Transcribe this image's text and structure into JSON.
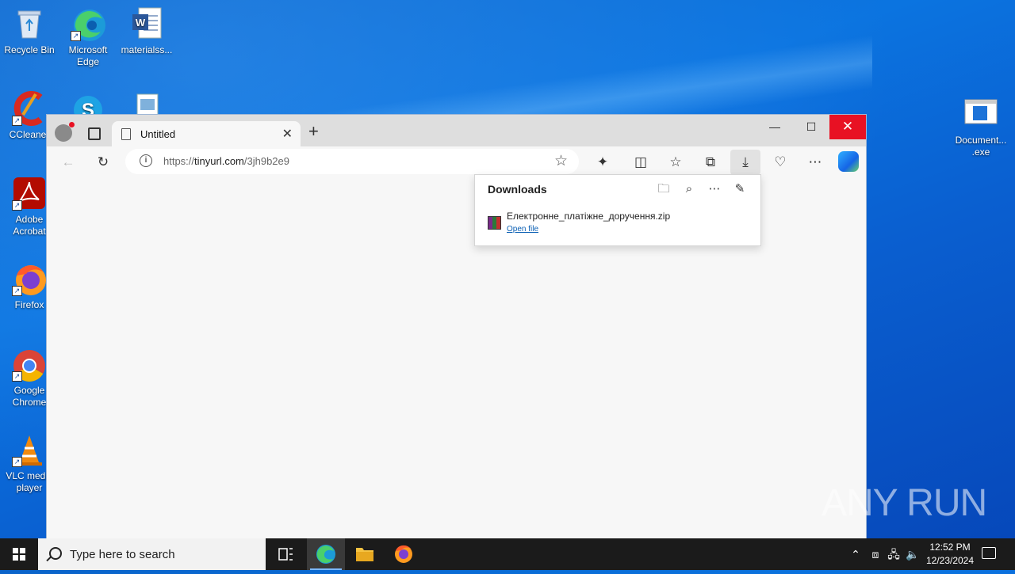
{
  "desktop": {
    "icons": [
      {
        "label": "Recycle Bin"
      },
      {
        "label": "Microsoft Edge"
      },
      {
        "label": "materialss..."
      },
      {
        "label": "CCleaner"
      },
      {
        "label": "Adobe Acrobat"
      },
      {
        "label": "Firefox"
      },
      {
        "label": "Google Chrome"
      },
      {
        "label": "VLC media player"
      },
      {
        "label": "Document... .exe"
      }
    ]
  },
  "browser": {
    "tab_title": "Untitled",
    "url_prefix": "https://",
    "url_host": "tinyurl.com",
    "url_path": "/3jh9b2e9",
    "downloads": {
      "header": "Downloads",
      "items": [
        {
          "filename": "Електронне_платіжне_доручення.zip",
          "action": "Open file"
        }
      ]
    }
  },
  "taskbar": {
    "search_placeholder": "Type here to search",
    "time": "12:52 PM",
    "date": "12/23/2024"
  },
  "watermark": "ANY RUN",
  "colors": {
    "close_red": "#e81123",
    "taskbar": "#1b1b1b",
    "desktop_blue": "#0a63c9"
  }
}
